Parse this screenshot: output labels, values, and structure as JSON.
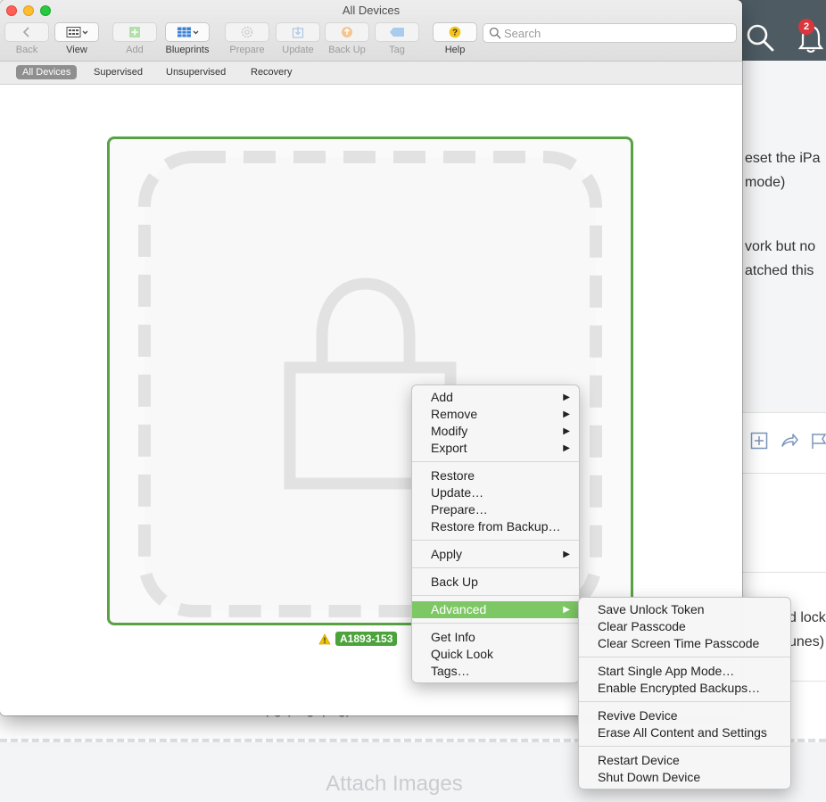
{
  "window": {
    "title": "All Devices"
  },
  "toolbar": {
    "back_label": "Back",
    "view_label": "View",
    "add_label": "Add",
    "blueprints_label": "Blueprints",
    "prepare_label": "Prepare",
    "update_label": "Update",
    "backup_label": "Back Up",
    "tag_label": "Tag",
    "help_label": "Help"
  },
  "search": {
    "placeholder": "Search",
    "value": ""
  },
  "scope_tabs": [
    {
      "label": "All Devices",
      "active": true
    },
    {
      "label": "Supervised",
      "active": false
    },
    {
      "label": "Unsupervised",
      "active": false
    },
    {
      "label": "Recovery",
      "active": false
    }
  ],
  "device": {
    "name": "A1893-153",
    "status_icon": "warning-icon"
  },
  "context_menu": {
    "items": [
      {
        "label": "Add",
        "submenu": true
      },
      {
        "label": "Remove",
        "submenu": true
      },
      {
        "label": "Modify",
        "submenu": true
      },
      {
        "label": "Export",
        "submenu": true
      },
      {
        "label": "Restore",
        "submenu": false
      },
      {
        "label": "Update…",
        "submenu": false
      },
      {
        "label": "Prepare…",
        "submenu": false
      },
      {
        "label": "Restore from Backup…",
        "submenu": false
      },
      {
        "label": "Apply",
        "submenu": true
      },
      {
        "label": "Back Up",
        "submenu": false
      },
      {
        "label": "Advanced",
        "submenu": true,
        "highlighted": true
      },
      {
        "label": "Get Info",
        "submenu": false
      },
      {
        "label": "Quick Look",
        "submenu": false
      },
      {
        "label": "Tags…",
        "submenu": false
      }
    ]
  },
  "advanced_submenu": {
    "items": [
      {
        "label": "Save Unlock Token"
      },
      {
        "label": "Clear Passcode"
      },
      {
        "label": "Clear Screen Time Passcode"
      },
      {
        "label": "Start Single App Mode…"
      },
      {
        "label": "Enable Encrypted Backups…"
      },
      {
        "label": "Revive Device"
      },
      {
        "label": "Erase All Content and Settings"
      },
      {
        "label": "Restart Device"
      },
      {
        "label": "Shut Down Device"
      }
    ]
  },
  "background_page": {
    "notification_count": "2",
    "lines": [
      "eset the iPa",
      "mode)",
      "vork but no",
      "atched this",
      "d lock",
      "unes)"
    ],
    "partial_text": "pg (.mg .png)",
    "attach_label": "Attach Images"
  },
  "colors": {
    "accent_green": "#7dc864",
    "frame_green": "#58a244",
    "badge_green": "#4ca33b",
    "topbar": "#4e5b63"
  }
}
